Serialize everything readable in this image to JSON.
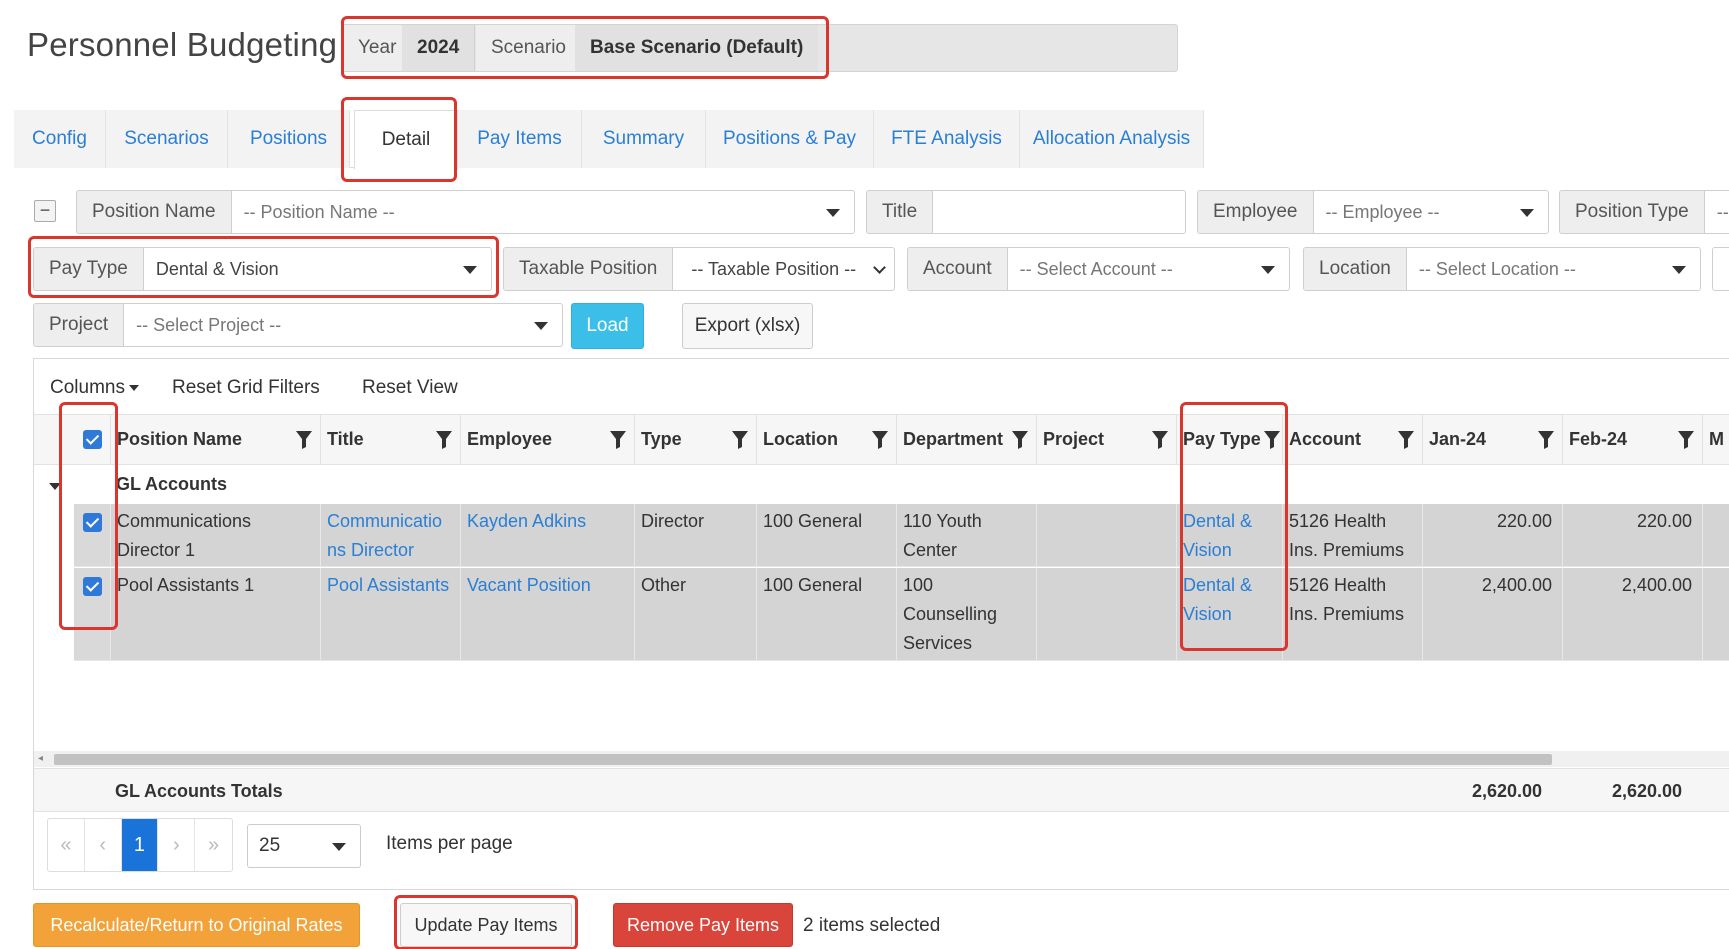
{
  "header": {
    "title": "Personnel Budgeting",
    "year_label": "Year",
    "year_value": "2024",
    "scenario_label": "Scenario",
    "scenario_value": "Base Scenario (Default)"
  },
  "tabs": [
    {
      "label": "Config"
    },
    {
      "label": "Scenarios"
    },
    {
      "label": "Positions"
    },
    {
      "label": "Detail",
      "active": true
    },
    {
      "label": "Pay Items"
    },
    {
      "label": "Summary"
    },
    {
      "label": "Positions & Pay"
    },
    {
      "label": "FTE Analysis"
    },
    {
      "label": "Allocation Analysis"
    }
  ],
  "filters": {
    "collapse_symbol": "−",
    "position_name": {
      "label": "Position Name",
      "placeholder": "-- Position Name --"
    },
    "title": {
      "label": "Title",
      "value": ""
    },
    "employee": {
      "label": "Employee",
      "placeholder": "-- Employee --"
    },
    "position_type": {
      "label": "Position Type",
      "placeholder": "--"
    },
    "pay_type": {
      "label": "Pay Type",
      "value": "Dental & Vision"
    },
    "taxable_position": {
      "label": "Taxable Position",
      "placeholder": "-- Taxable Position --"
    },
    "account": {
      "label": "Account",
      "placeholder": "-- Select Account --"
    },
    "location": {
      "label": "Location",
      "placeholder": "-- Select Location --"
    },
    "project": {
      "label": "Project",
      "placeholder": "-- Select Project --"
    },
    "load_label": "Load",
    "export_label": "Export (xlsx)"
  },
  "grid": {
    "toolbar": {
      "columns_label": "Columns",
      "reset_filters_label": "Reset Grid Filters",
      "reset_view_label": "Reset View"
    },
    "columns": [
      "Position Name",
      "Title",
      "Employee",
      "Type",
      "Location",
      "Department",
      "Project",
      "Pay Type",
      "Account",
      "Jan-24",
      "Feb-24",
      "M"
    ],
    "group_label": "GL Accounts",
    "rows": [
      {
        "position_name_l1": "Communications",
        "position_name_l2": "Director 1",
        "title_l1": "Communicatio",
        "title_l2": "ns Director",
        "employee": "Kayden Adkins",
        "type": "Director",
        "location": "100 General",
        "department_l1": "110 Youth",
        "department_l2": "Center",
        "department_l3": "",
        "project": "",
        "pay_type_l1": "Dental &",
        "pay_type_l2": "Vision",
        "account_l1": "5126 Health",
        "account_l2": "Ins. Premiums",
        "jan": "220.00",
        "feb": "220.00"
      },
      {
        "position_name_l1": "Pool Assistants 1",
        "position_name_l2": "",
        "title_l1": "Pool Assistants",
        "title_l2": "",
        "employee": "Vacant Position",
        "type": "Other",
        "location": "100 General",
        "department_l1": "100",
        "department_l2": "Counselling",
        "department_l3": "Services",
        "project": "",
        "pay_type_l1": "Dental &",
        "pay_type_l2": "Vision",
        "account_l1": "5126 Health",
        "account_l2": "Ins. Premiums",
        "jan": "2,400.00",
        "feb": "2,400.00"
      }
    ],
    "totals_label": "GL Accounts Totals",
    "totals_jan": "2,620.00",
    "totals_feb": "2,620.00",
    "pager": {
      "first": "«",
      "prev": "‹",
      "current_page": "1",
      "next": "›",
      "last": "»",
      "page_size": "25",
      "items_per_page_label": "Items per page"
    }
  },
  "actions": {
    "recalculate_label": "Recalculate/Return to Original Rates",
    "update_label": "Update Pay Items",
    "remove_label": "Remove Pay Items",
    "selection_count": "2 items selected"
  },
  "colors": {
    "link": "#2a7fd5",
    "load_button": "#3bbfe8",
    "orange_button": "#f3a23a",
    "red_button": "#d9453b",
    "highlight_box": "#d9362e",
    "checkbox": "#2f7ad8"
  },
  "icons": [
    "filter-icon",
    "caret-down-icon",
    "chevron-down-icon",
    "checkbox-checked-icon",
    "collapse-minus-icon"
  ]
}
